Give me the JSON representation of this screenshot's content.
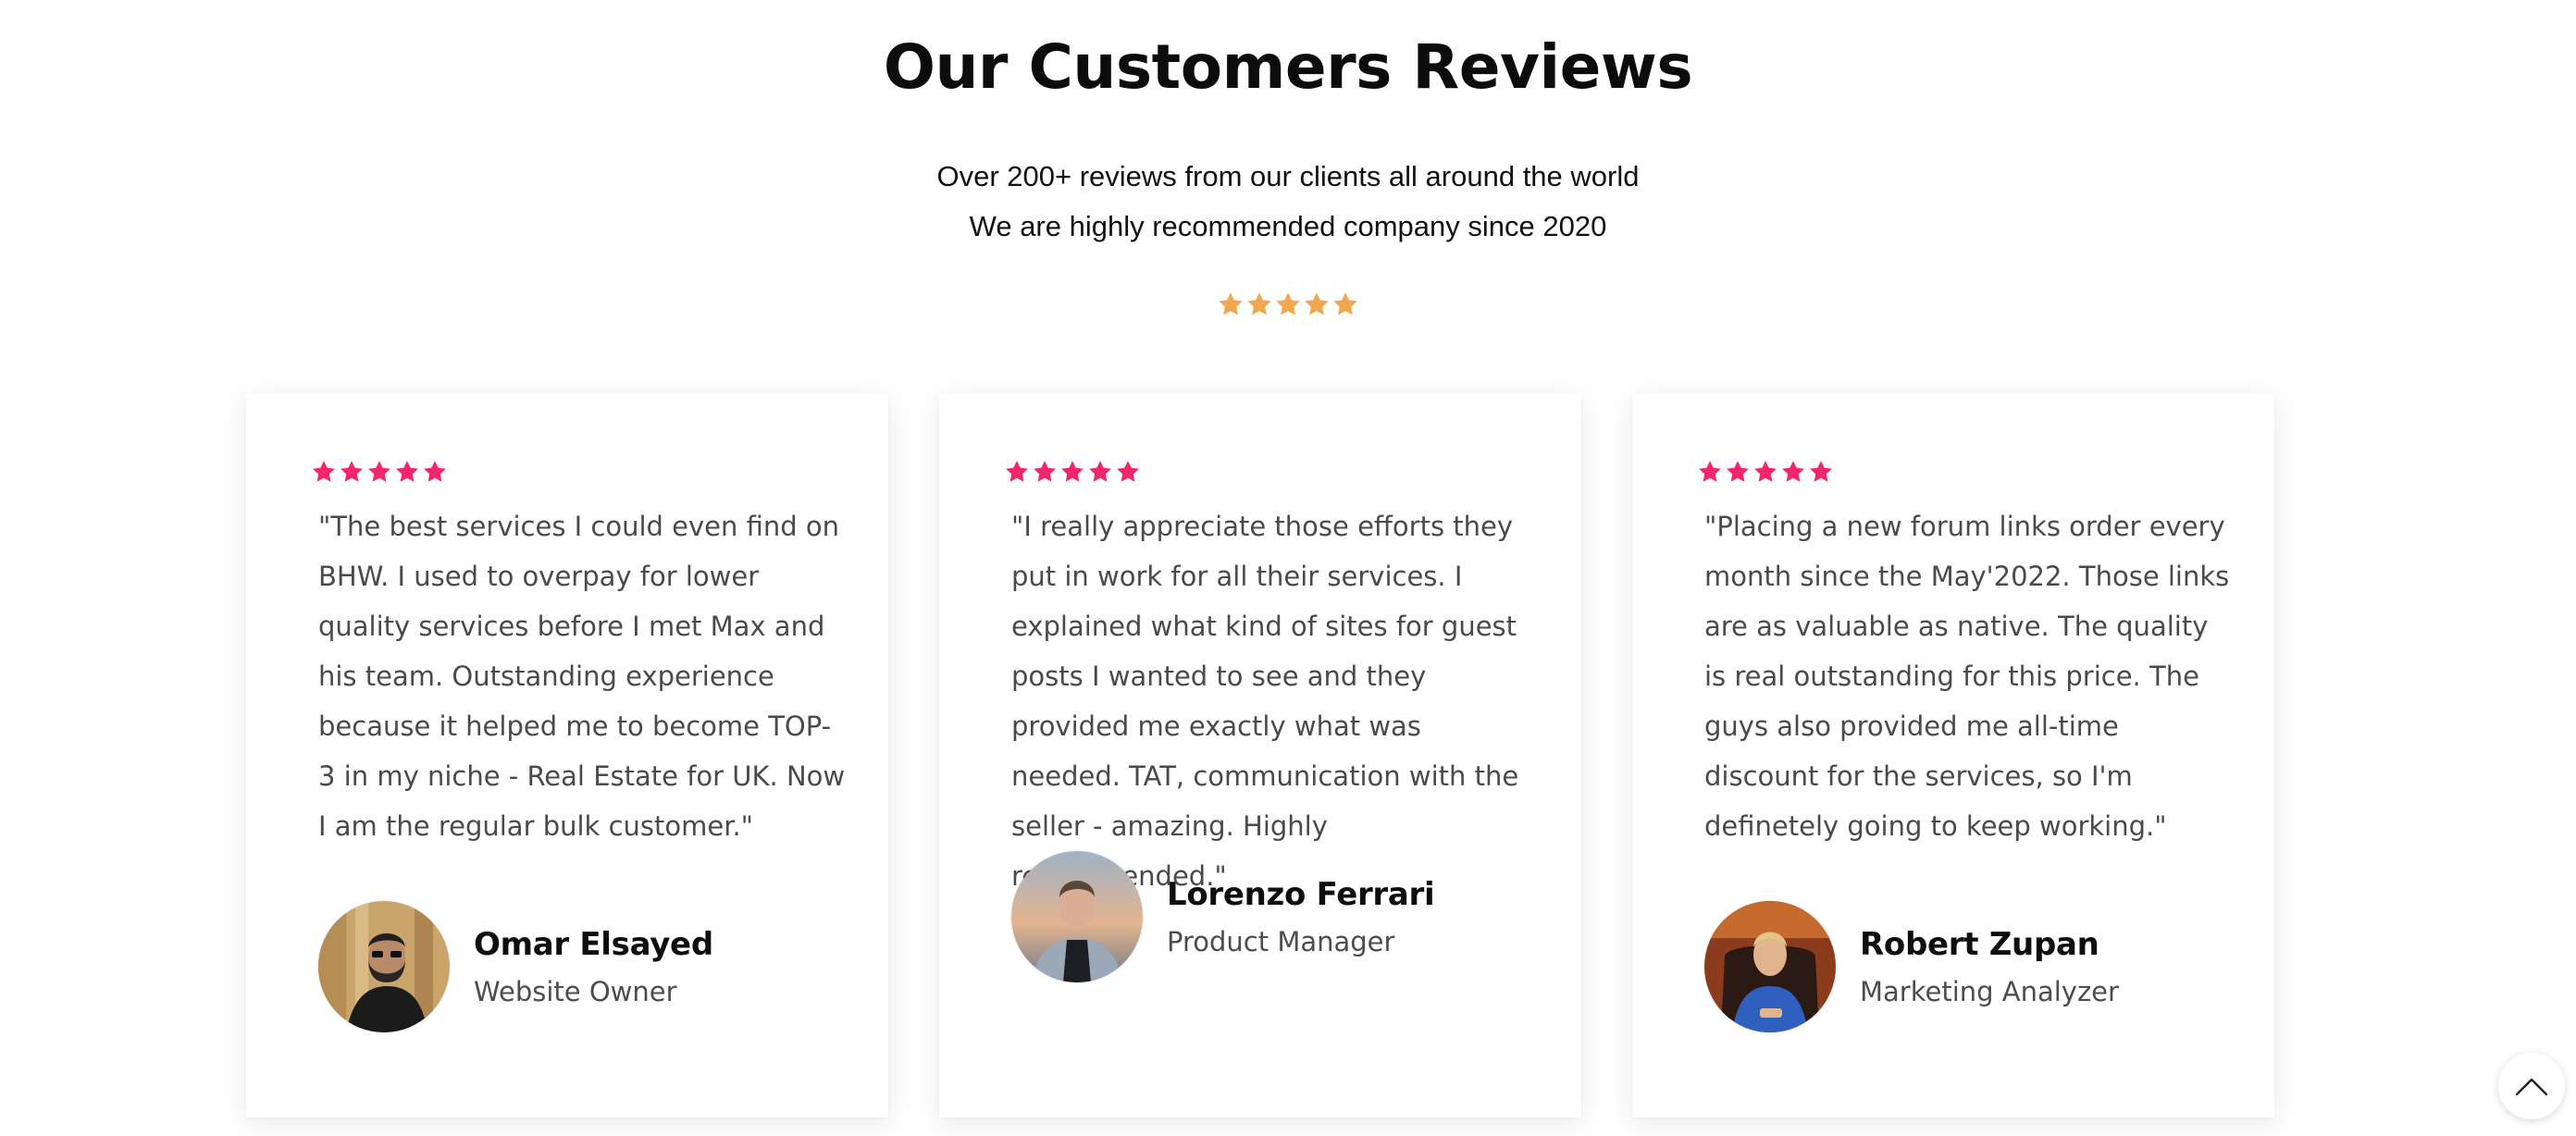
{
  "section": {
    "title": "Our Customers Reviews",
    "subtitle_line1": "Over 200+ reviews from our clients all around the world",
    "subtitle_line2": "We are highly recommended company since 2020",
    "overall_rating": 5,
    "overall_star_color": "#F0A84E"
  },
  "reviews": [
    {
      "rating": 5,
      "star_color": "#F2266E",
      "quote": "\"The best services I could even find on BHW. I used to overpay for lower quality services before I met Max and his team. Outstanding experience because it helped me to become TOP-3 in my niche - Real Estate for UK. Now I am the regular bulk customer.\"",
      "name": "Omar Elsayed",
      "role": "Website Owner"
    },
    {
      "rating": 5,
      "star_color": "#F2266E",
      "quote": "\"I really appreciate those efforts they put in work for all their services. I explained what kind of sites for guest posts I wanted to see and they provided me exactly what was needed. TAT, communication with the seller - amazing. Highly recommended.\"",
      "name": "Lorenzo Ferrari",
      "role": "Product Manager"
    },
    {
      "rating": 5,
      "star_color": "#F2266E",
      "quote": "\"Placing a new forum links order every month since the May'2022. Those links are as valuable as native. The quality is real outstanding for this price. The guys also provided me all-time discount for the services, so I'm definetely going to keep working.\"",
      "name": "Robert Zupan",
      "role": "Marketing Analyzer"
    }
  ],
  "scroll_top": {
    "icon": "chevron-up-icon"
  }
}
